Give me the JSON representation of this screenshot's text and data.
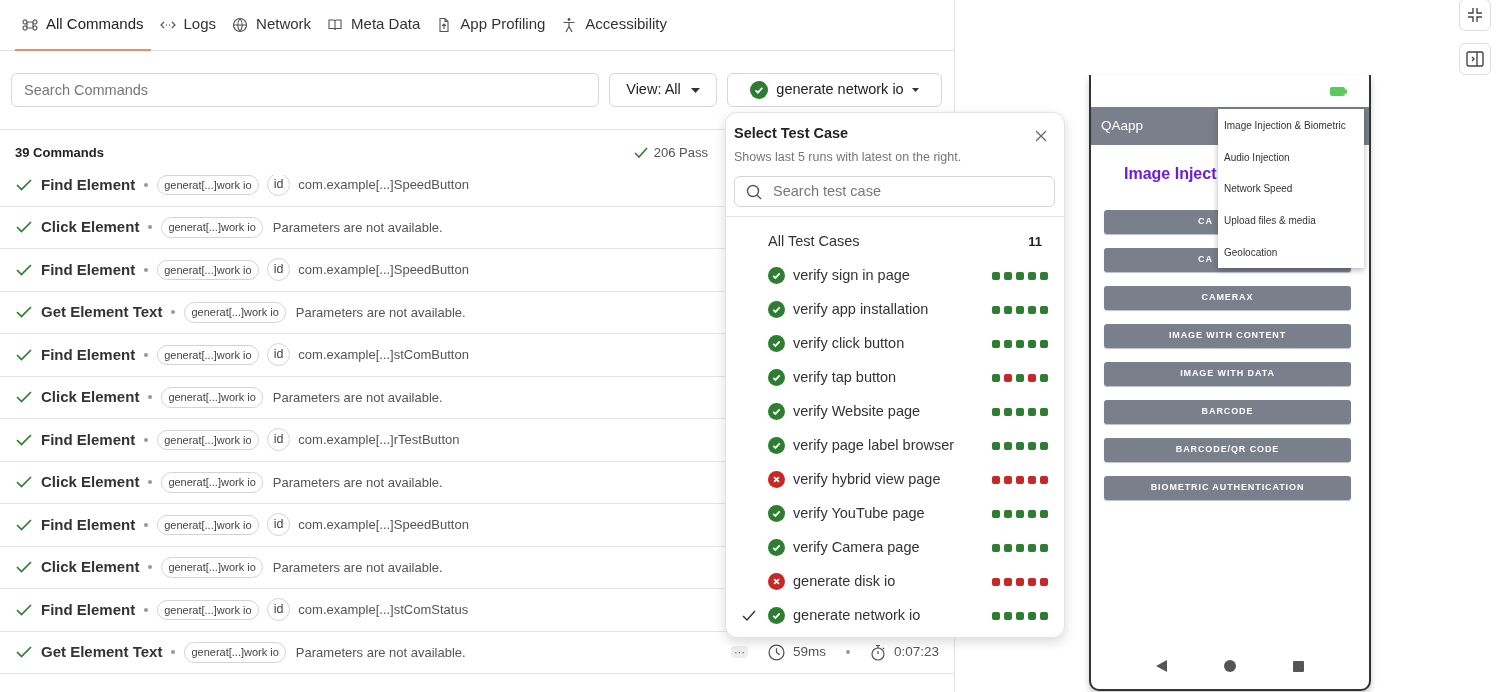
{
  "tabs": [
    {
      "label": "All Commands",
      "selected": true
    },
    {
      "label": "Logs",
      "selected": false
    },
    {
      "label": "Network",
      "selected": false
    },
    {
      "label": "Meta Data",
      "selected": false
    },
    {
      "label": "App Profiling",
      "selected": false
    },
    {
      "label": "Accessibility",
      "selected": false
    }
  ],
  "search": {
    "placeholder": "Search Commands"
  },
  "view_button": "View: All",
  "test_case_button": {
    "label": "generate network io",
    "passed": true
  },
  "commands_count": "39 Commands",
  "passed_summary": "206 Pass",
  "commands": [
    {
      "name": "Find Element",
      "passed": true,
      "tag": "generat[...]work io",
      "kind": "locator",
      "locator": "id",
      "value": "com.example[...]SpeedButton"
    },
    {
      "name": "Click Element",
      "passed": true,
      "tag": "generat[...]work io",
      "kind": "plain",
      "value": "Parameters are not available."
    },
    {
      "name": "Find Element",
      "passed": true,
      "tag": "generat[...]work io",
      "kind": "locator",
      "locator": "id",
      "value": "com.example[...]SpeedButton"
    },
    {
      "name": "Get Element Text",
      "passed": true,
      "tag": "generat[...]work io",
      "kind": "plain",
      "value": "Parameters are not available."
    },
    {
      "name": "Find Element",
      "passed": true,
      "tag": "generat[...]work io",
      "kind": "locator",
      "locator": "id",
      "value": "com.example[...]stComButton"
    },
    {
      "name": "Click Element",
      "passed": true,
      "tag": "generat[...]work io",
      "kind": "plain",
      "value": "Parameters are not available."
    },
    {
      "name": "Find Element",
      "passed": true,
      "tag": "generat[...]work io",
      "kind": "locator",
      "locator": "id",
      "value": "com.example[...]rTestButton"
    },
    {
      "name": "Click Element",
      "passed": true,
      "tag": "generat[...]work io",
      "kind": "plain",
      "value": "Parameters are not available."
    },
    {
      "name": "Find Element",
      "passed": true,
      "tag": "generat[...]work io",
      "kind": "locator",
      "locator": "id",
      "value": "com.example[...]SpeedButton"
    },
    {
      "name": "Click Element",
      "passed": true,
      "tag": "generat[...]work io",
      "kind": "plain",
      "value": "Parameters are not available."
    },
    {
      "name": "Find Element",
      "passed": true,
      "tag": "generat[...]work io",
      "kind": "locator",
      "locator": "id",
      "value": "com.example[...]stComStatus"
    },
    {
      "name": "Get Element Text",
      "passed": true,
      "tag": "generat[...]work io",
      "kind": "plain",
      "value": "Parameters are not available.",
      "more": "···",
      "duration": "59ms",
      "elapsed": "0:07:23"
    }
  ],
  "test_case_popover": {
    "title": "Select Test Case",
    "subtitle": "Shows last 5 runs with latest on the right.",
    "search_placeholder": "Search test case",
    "all_label": "All Test Cases",
    "all_count": "11",
    "cases": [
      {
        "name": "verify sign in page",
        "passed": true,
        "selected": false,
        "runs": [
          true,
          true,
          true,
          true,
          true
        ]
      },
      {
        "name": "verify app installation",
        "passed": true,
        "selected": false,
        "runs": [
          true,
          true,
          true,
          true,
          true
        ]
      },
      {
        "name": "verify click button",
        "passed": true,
        "selected": false,
        "runs": [
          true,
          true,
          true,
          true,
          true
        ]
      },
      {
        "name": "verify tap button",
        "passed": true,
        "selected": false,
        "runs": [
          true,
          false,
          true,
          false,
          true
        ]
      },
      {
        "name": "verify Website page",
        "passed": true,
        "selected": false,
        "runs": [
          true,
          true,
          true,
          true,
          true
        ]
      },
      {
        "name": "verify page label browser",
        "passed": true,
        "selected": false,
        "runs": [
          true,
          true,
          true,
          true,
          true
        ]
      },
      {
        "name": "verify hybrid view page",
        "passed": false,
        "selected": false,
        "runs": [
          false,
          false,
          false,
          false,
          false
        ]
      },
      {
        "name": "verify YouTube page",
        "passed": true,
        "selected": false,
        "runs": [
          true,
          true,
          true,
          true,
          true
        ]
      },
      {
        "name": "verify Camera page",
        "passed": true,
        "selected": false,
        "runs": [
          true,
          true,
          true,
          true,
          true
        ]
      },
      {
        "name": "generate disk io",
        "passed": false,
        "selected": false,
        "runs": [
          false,
          false,
          false,
          false,
          false
        ]
      },
      {
        "name": "generate network io",
        "passed": true,
        "selected": true,
        "runs": [
          true,
          true,
          true,
          true,
          true
        ]
      }
    ]
  },
  "device": {
    "app_title": "QAapp",
    "heading": "Image Inject",
    "buttons": [
      {
        "label": "CA",
        "kind": "covered"
      },
      {
        "label": "CA",
        "kind": "covered"
      },
      {
        "label": "CAMERAX",
        "kind": "full"
      },
      {
        "label": "IMAGE WITH CONTENT",
        "kind": "full"
      },
      {
        "label": "IMAGE WITH DATA",
        "kind": "full"
      },
      {
        "label": "BARCODE",
        "kind": "full"
      },
      {
        "label": "BARCODE/QR CODE",
        "kind": "full"
      },
      {
        "label": "BIOMETRIC AUTHENTICATION",
        "kind": "full"
      }
    ],
    "menu": [
      "Image Injection & Biometric",
      "Audio Injection",
      "Network Speed",
      "Upload files & media",
      "Geolocation"
    ]
  }
}
